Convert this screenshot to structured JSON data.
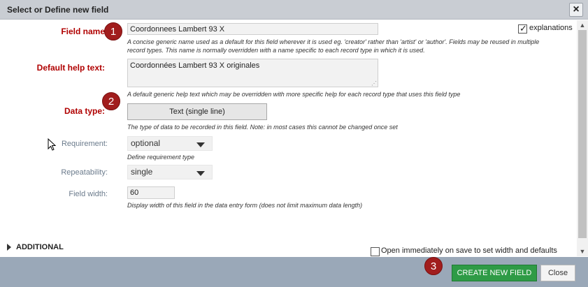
{
  "dialog": {
    "title": "Select or Define new field",
    "close_icon": "close-icon"
  },
  "form": {
    "field_name": {
      "label": "Field name",
      "value": "Coordonnees Lambert 93 X",
      "help": "A concise generic name used as a default for this field wherever it is used eg. 'creator' rather than 'artist' or 'author'. Fields may be reused in multiple record types. This name is normally overridden with a name specific to each record type in which it is used."
    },
    "explanations": {
      "label": "explanations",
      "checked": true
    },
    "default_help": {
      "label": "Default help text:",
      "value": "Coordonnées Lambert 93 X originales",
      "help": "A default generic help text which may be overridden with more specific help for each record type that uses this field type"
    },
    "data_type": {
      "label": "Data type:",
      "value": "Text (single line)",
      "help": "The type of data to be recorded in this field. Note: in most cases this cannot be changed once set"
    },
    "requirement": {
      "label": "Requirement:",
      "value": "optional",
      "help": "Define requirement type"
    },
    "repeatability": {
      "label": "Repeatability:",
      "value": "single"
    },
    "field_width": {
      "label": "Field width:",
      "value": "60",
      "help": "Display width of this field in the data entry form (does not limit maximum data length)"
    },
    "additional": {
      "label": "ADDITIONAL"
    },
    "open_immediately": {
      "label": "Open immediately on save to set width and defaults",
      "checked": false
    }
  },
  "markers": [
    "1",
    "2",
    "3"
  ],
  "footer": {
    "create_label": "CREATE NEW FIELD",
    "close_label": "Close"
  }
}
